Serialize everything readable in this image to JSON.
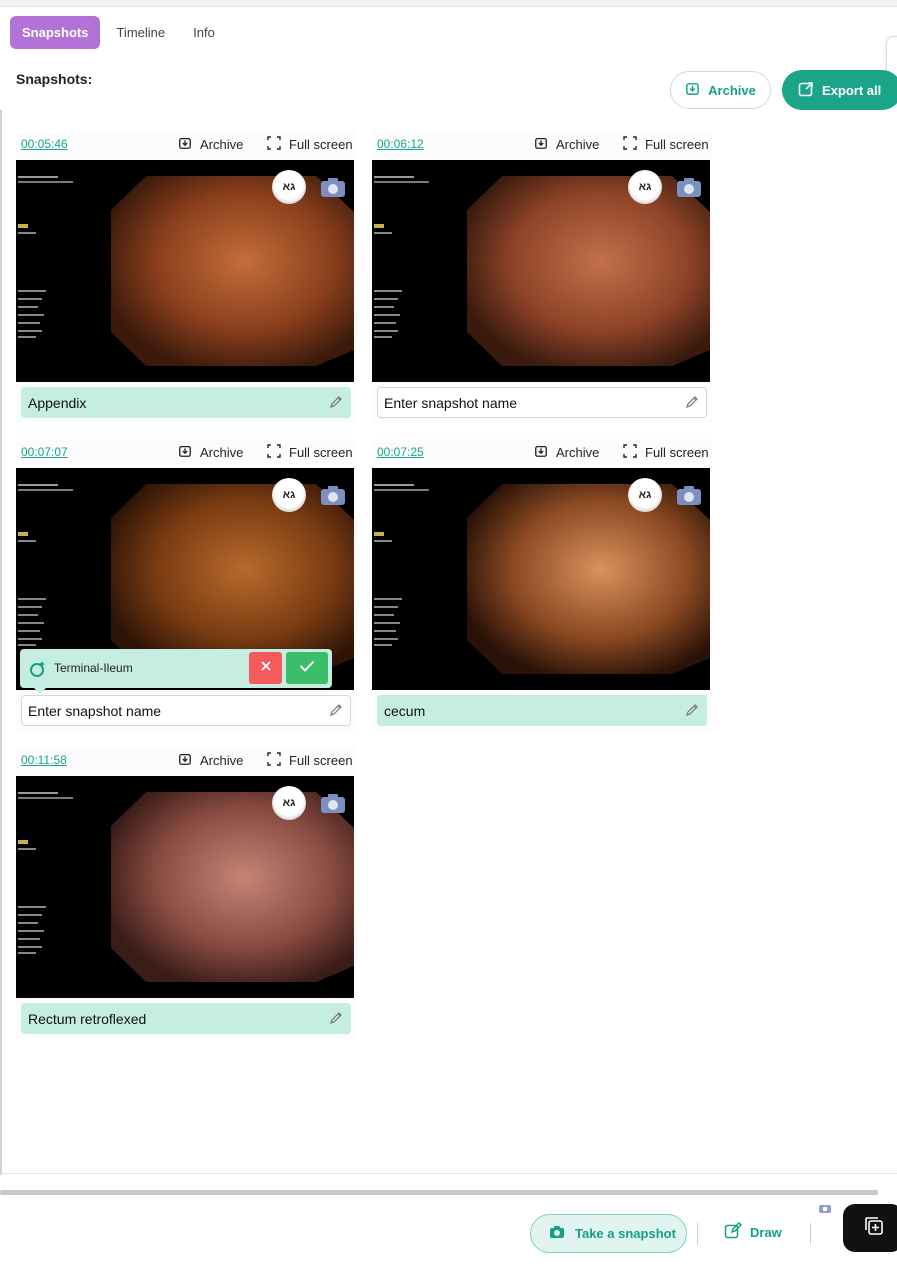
{
  "tabs": [
    {
      "label": "Snapshots",
      "active": true
    },
    {
      "label": "Timeline",
      "active": false
    },
    {
      "label": "Info",
      "active": false
    }
  ],
  "section_title": "Snapshots:",
  "toolbar": {
    "archive_label": "Archive",
    "export_label": "Export all"
  },
  "snapshots": [
    {
      "time": "00:05:46",
      "archive_label": "Archive",
      "fullscreen_label": "Full screen",
      "name": "Appendix",
      "placeholder": "Enter snapshot name",
      "badge": "גא"
    },
    {
      "time": "00:06:12",
      "archive_label": "Archive",
      "fullscreen_label": "Full screen",
      "name": "",
      "placeholder": "Enter snapshot name",
      "badge": "גא"
    },
    {
      "time": "00:07:07",
      "archive_label": "Archive",
      "fullscreen_label": "Full screen",
      "name": "",
      "placeholder": "Enter snapshot name",
      "badge": "גא"
    },
    {
      "time": "00:07:25",
      "archive_label": "Archive",
      "fullscreen_label": "Full screen",
      "name": "cecum",
      "placeholder": "Enter snapshot name",
      "badge": "גא"
    },
    {
      "time": "00:11:58",
      "archive_label": "Archive",
      "fullscreen_label": "Full screen",
      "name": "Rectum retroflexed",
      "placeholder": "Enter snapshot name",
      "badge": "גא"
    }
  ],
  "ai_suggestion": {
    "label": "Terminal-Ileum"
  },
  "bottom_bar": {
    "take_snapshot_label": "Take a snapshot",
    "draw_label": "Draw"
  },
  "colors": {
    "accent": "#1aa589",
    "tab_active": "#b373d6",
    "name_filled_bg": "#c6ede2",
    "reject": "#f45c5c",
    "accept": "#3bbd6a"
  }
}
